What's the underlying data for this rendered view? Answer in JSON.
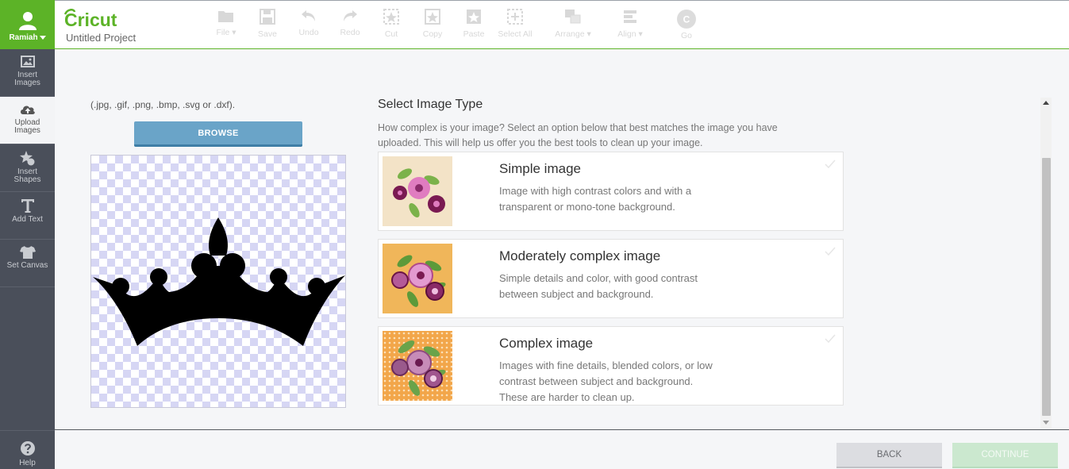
{
  "app": {
    "brand": "Cricut",
    "project_title": "Untitled Project",
    "accent_color": "#5cb327"
  },
  "user": {
    "name": "Ramiah"
  },
  "sidebar": {
    "items": [
      {
        "label": "Insert\nImages",
        "icon": "image-icon"
      },
      {
        "label": "Upload\nImages",
        "icon": "cloud-upload-icon",
        "active": true
      },
      {
        "label": "Insert\nShapes",
        "icon": "shapes-icon"
      },
      {
        "label": "Add Text",
        "icon": "text-icon"
      },
      {
        "label": "Set Canvas",
        "icon": "tshirt-icon"
      }
    ],
    "help_label": "Help"
  },
  "toolbar": {
    "file": "File",
    "save": "Save",
    "undo": "Undo",
    "redo": "Redo",
    "cut": "Cut",
    "copy": "Copy",
    "paste": "Paste",
    "select_all": "Select All",
    "arrange": "Arrange",
    "align": "Align",
    "go": "Go",
    "go_badge": "C"
  },
  "upload": {
    "formats": "(.jpg, .gif, .png, .bmp, .svg or .dxf).",
    "browse_label": "BROWSE"
  },
  "image_type": {
    "title": "Select Image Type",
    "description": "How complex is your image? Select an option below that best matches the image you have uploaded. This will help us offer you the best tools to clean up your image.",
    "options": [
      {
        "title": "Simple image",
        "description": "Image with high contrast colors and with a transparent or mono-tone background."
      },
      {
        "title": "Moderately complex image",
        "description": "Simple details and color, with good contrast between subject and background."
      },
      {
        "title": "Complex image",
        "description": "Images with fine details, blended colors, or low contrast between subject and background. These are harder to clean up."
      }
    ]
  },
  "footer": {
    "back_label": "BACK",
    "continue_label": "CONTINUE"
  }
}
